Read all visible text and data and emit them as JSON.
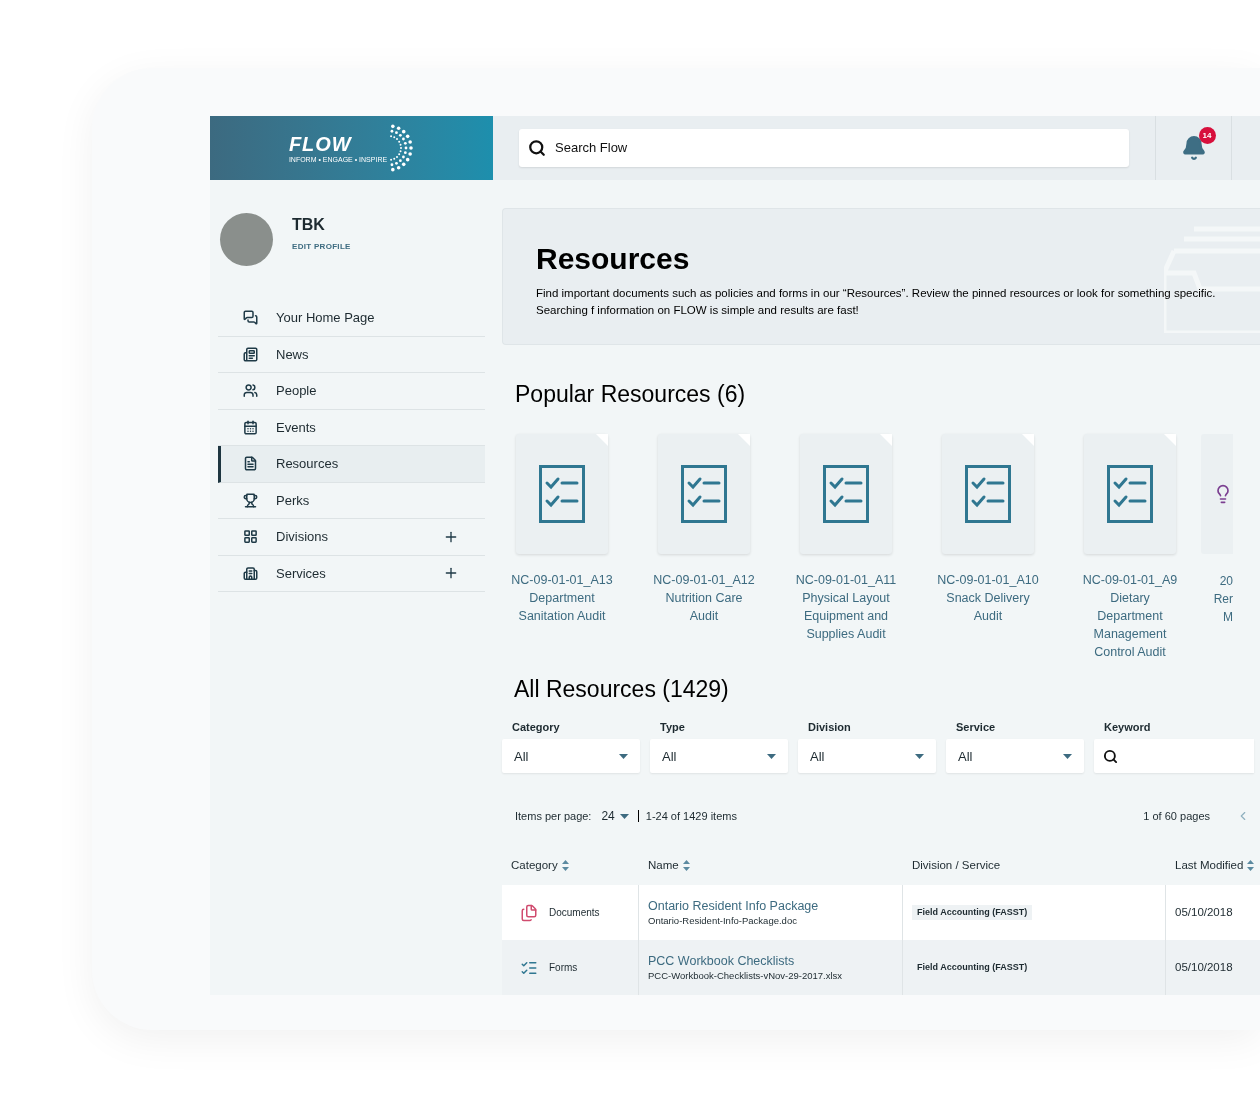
{
  "logo": {
    "text": "FLOW",
    "tagline": "INFORM • ENGAGE • INSPIRE"
  },
  "search": {
    "placeholder": "Search Flow"
  },
  "notifications": {
    "count": "14"
  },
  "profile": {
    "name": "TBK",
    "edit_link": "EDIT PROFILE"
  },
  "sidebar": {
    "items": [
      {
        "label": "Your Home Page",
        "selected": false,
        "expandable": false
      },
      {
        "label": "News",
        "selected": false,
        "expandable": false
      },
      {
        "label": "People",
        "selected": false,
        "expandable": false
      },
      {
        "label": "Events",
        "selected": false,
        "expandable": false
      },
      {
        "label": "Resources",
        "selected": true,
        "expandable": false
      },
      {
        "label": "Perks",
        "selected": false,
        "expandable": false
      },
      {
        "label": "Divisions",
        "selected": false,
        "expandable": true
      },
      {
        "label": "Services",
        "selected": false,
        "expandable": true
      }
    ]
  },
  "banner": {
    "title": "Resources",
    "description": "Find important documents such as policies and forms in our “Resources”. Review the pinned resources or look for something specific. Searching f information on FLOW is simple and results are fast!"
  },
  "popular": {
    "title": "Popular Resources (6)",
    "items": [
      {
        "kind": "checklist",
        "lines": [
          "NC-09-01-01_A13",
          "Department",
          "Sanitation Audit"
        ]
      },
      {
        "kind": "checklist",
        "lines": [
          "NC-09-01-01_A12",
          "Nutrition Care",
          "Audit"
        ]
      },
      {
        "kind": "checklist",
        "lines": [
          "NC-09-01-01_A11",
          "Physical Layout",
          "Equipment and",
          "Supplies Audit"
        ]
      },
      {
        "kind": "checklist",
        "lines": [
          "NC-09-01-01_A10",
          "Snack Delivery",
          "Audit"
        ]
      },
      {
        "kind": "checklist",
        "lines": [
          "NC-09-01-01_A9",
          "Dietary",
          "Department",
          "Management",
          "Control Audit"
        ]
      },
      {
        "kind": "bulb",
        "lines": [
          "20",
          "Rer",
          "M"
        ]
      }
    ]
  },
  "all": {
    "title": "All Resources (1429)",
    "filters": [
      {
        "label": "Category",
        "value": "All",
        "kind": "select"
      },
      {
        "label": "Type",
        "value": "All",
        "kind": "select"
      },
      {
        "label": "Division",
        "value": "All",
        "kind": "select"
      },
      {
        "label": "Service",
        "value": "All",
        "kind": "select"
      },
      {
        "label": "Keyword",
        "kind": "search"
      }
    ],
    "items_per_page_label": "Items per page:",
    "items_per_page": "24",
    "range": "1-24 of 1429 items",
    "pages": "1 of 60 pages",
    "columns": [
      {
        "label": "Category",
        "sortable": true
      },
      {
        "label": "Name",
        "sortable": true
      },
      {
        "label": "Division / Service",
        "sortable": false
      },
      {
        "label": "Last Modified",
        "sortable": true
      }
    ],
    "rows": [
      {
        "kind": "document",
        "category": "Documents",
        "name": "Ontario Resident Info Package",
        "file": "Ontario-Resident-Info-Package.doc",
        "division": "Field Accounting (FASST)",
        "modified": "05/10/2018"
      },
      {
        "kind": "form",
        "category": "Forms",
        "name": "PCC Workbook Checklists",
        "file": "PCC-Workbook-Checklists-vNov-29-2017.xlsx",
        "division": "Field Accounting (FASST)",
        "modified": "05/10/2018"
      }
    ]
  }
}
